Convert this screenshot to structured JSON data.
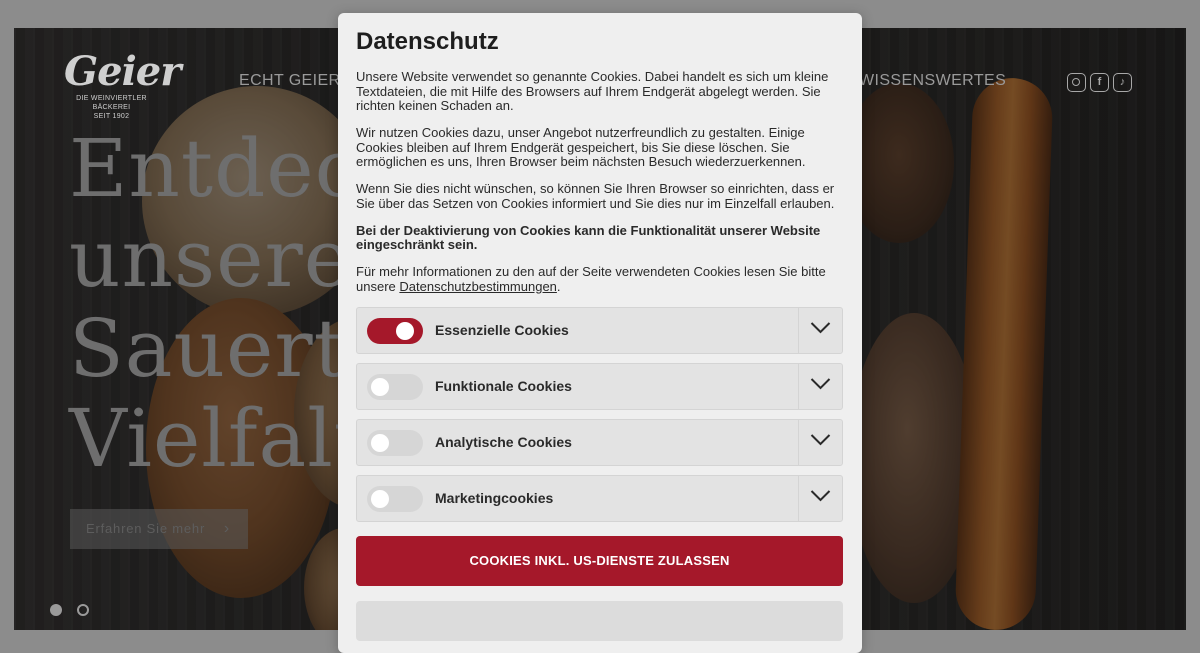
{
  "site": {
    "logo_word": "Geier",
    "logo_sub1": "DIE WEINVIERTLER BÄCKEREI",
    "logo_sub2": "SEIT 1902",
    "nav": {
      "left_item": "ECHT GEIER",
      "right_item": "WISSENSWERTES"
    },
    "social": [
      {
        "icon": "instagram-icon",
        "glyph": ""
      },
      {
        "icon": "facebook-icon",
        "glyph": "f"
      },
      {
        "icon": "tiktok-icon",
        "glyph": "♪"
      }
    ],
    "hero": {
      "headline_lines": [
        "Entdeck",
        "unsere",
        "Sauerte",
        "Vielfalt"
      ],
      "button_label": "Erfahren Sie mehr",
      "slides_total": 2,
      "active_slide": 1
    }
  },
  "consent": {
    "title": "Datenschutz",
    "paragraph1": "Unsere Website verwendet so genannte Cookies. Dabei handelt es sich um kleine Textdateien, die mit Hilfe des Browsers auf Ihrem Endgerät abgelegt werden. Sie richten keinen Schaden an.",
    "paragraph2": "Wir nutzen Cookies dazu, unser Angebot nutzerfreundlich zu gestalten. Einige Cookies bleiben auf Ihrem Endgerät gespeichert, bis Sie diese löschen. Sie ermöglichen es uns, Ihren Browser beim nächsten Besuch wiederzuerkennen.",
    "paragraph3": "Wenn Sie dies nicht wünschen, so können Sie Ihren Browser so einrichten, dass er Sie über das Setzen von Cookies informiert und Sie dies nur im Einzelfall erlauben.",
    "paragraph4_bold": "Bei der Deaktivierung von Cookies kann die Funktionalität unserer Website eingeschränkt sein.",
    "paragraph5_text": "Für mehr Informationen zu den auf der Seite verwendeten Cookies lesen Sie bitte unsere ",
    "paragraph5_link": "Datenschutzbestimmungen",
    "paragraph5_end": ".",
    "categories": [
      {
        "label": "Essenzielle Cookies",
        "enabled": true
      },
      {
        "label": "Funktionale Cookies",
        "enabled": false
      },
      {
        "label": "Analytische Cookies",
        "enabled": false
      },
      {
        "label": "Marketingcookies",
        "enabled": false
      }
    ],
    "accept_button": "COOKIES INKL. US-DIENSTE ZULASSEN"
  },
  "colors": {
    "accent_red": "#a5182a",
    "modal_bg": "#efefef",
    "row_bg": "#e3e3e3",
    "overlay": "#8c8c8c"
  }
}
